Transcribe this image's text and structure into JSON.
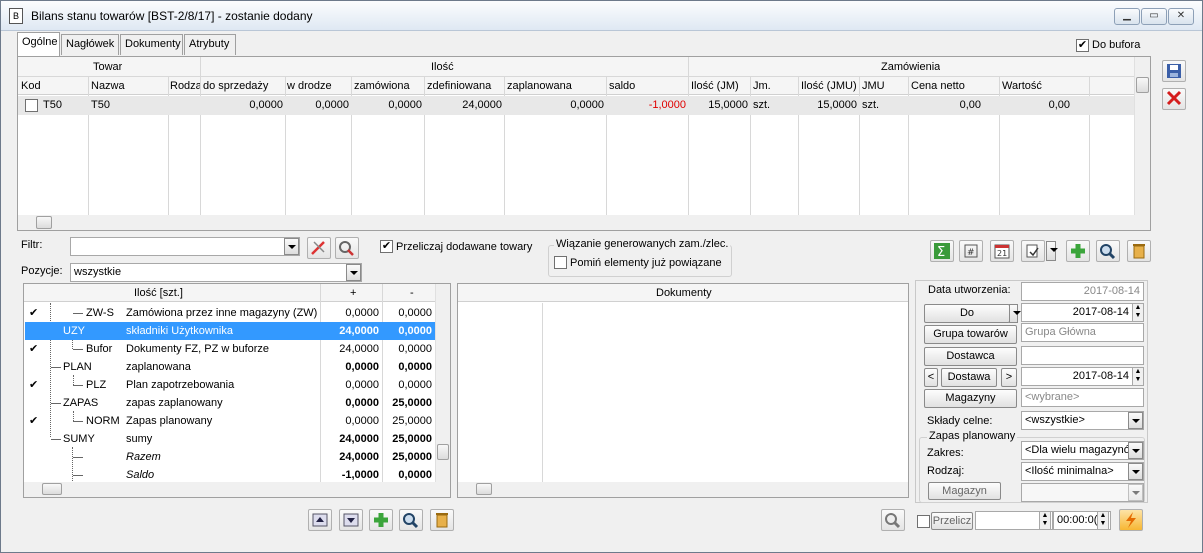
{
  "window": {
    "title": "Bilans stanu towarów [BST-2/8/17] - zostanie dodany",
    "min": "▁",
    "max": "▭",
    "close": "✕"
  },
  "tabs": [
    "Ogólne",
    "Nagłówek",
    "Dokumenty",
    "Atrybuty"
  ],
  "do_bufora": "Do bufora",
  "grid": {
    "groups": {
      "towar": "Towar",
      "ilosc": "Ilość",
      "zamowienia": "Zamówienia"
    },
    "columns": [
      "Kod",
      "Nazwa",
      "Rodza",
      "do sprzedaży",
      "w drodze",
      "zamówiona",
      "zdefiniowana",
      "zaplanowana",
      "saldo",
      "Ilość (JM)",
      "Jm.",
      "Ilość (JMU)",
      "JMU",
      "Cena netto",
      "Wartość"
    ],
    "row": [
      "T50",
      "T50",
      "",
      "0,0000",
      "0,0000",
      "0,0000",
      "24,0000",
      "0,0000",
      "-1,0000",
      "15,0000",
      "szt.",
      "15,0000",
      "szt.",
      "0,00",
      "0,00"
    ]
  },
  "filtr_label": "Filtr:",
  "filtr_value": "",
  "przeliczaj": "Przeliczaj dodawane towary",
  "wiazanie": "Wiązanie generowanych zam./zlec.",
  "pomin": "Pomiń elementy już powiązane",
  "pozycje_label": "Pozycje:",
  "pozycje_value": "wszystkie",
  "tree": {
    "headers": [
      "Ilość [szt.]",
      "+",
      "-"
    ],
    "rows": [
      {
        "code": "ZW-S",
        "name": "Zamówiona przez inne magazyny (ZW)",
        "plus": "0,0000",
        "minus": "0,0000"
      },
      {
        "code": "UZY",
        "name": "składniki Użytkownika",
        "plus": "24,0000",
        "minus": "0,0000"
      },
      {
        "code": "Bufor",
        "name": "Dokumenty FZ, PZ w buforze",
        "plus": "24,0000",
        "minus": "0,0000"
      },
      {
        "code": "PLAN",
        "name": "zaplanowana",
        "plus": "0,0000",
        "minus": "0,0000"
      },
      {
        "code": "PLZ",
        "name": "Plan zapotrzebowania",
        "plus": "0,0000",
        "minus": "0,0000"
      },
      {
        "code": "ZAPAS",
        "name": "zapas zaplanowany",
        "plus": "0,0000",
        "minus": "25,0000"
      },
      {
        "code": "NORM",
        "name": "Zapas planowany",
        "plus": "0,0000",
        "minus": "25,0000"
      },
      {
        "code": "SUMY",
        "name": "sumy",
        "plus": "24,0000",
        "minus": "25,0000"
      },
      {
        "code": "",
        "name": "Razem",
        "plus": "24,0000",
        "minus": "25,0000"
      },
      {
        "code": "",
        "name": "Saldo",
        "plus": "-1,0000",
        "minus": "0,0000"
      }
    ]
  },
  "dokumenty": "Dokumenty",
  "right": {
    "data_utworzenia": "Data utworzenia:",
    "data_utworzenia_val": "2017-08-14",
    "do": "Do",
    "do_val": "2017-08-14",
    "grupa": "Grupa towarów",
    "grupa_val": "Grupa Główna",
    "dostawca": "Dostawca",
    "dostawa": "Dostawa",
    "dostawa_val": "2017-08-14",
    "magazyny": "Magazyny",
    "magazyny_val": "<wybrane>",
    "sklady": "Składy celne:",
    "sklady_val": "<wszystkie>",
    "zapas": "Zapas planowany",
    "zakres": "Zakres:",
    "zakres_val": "<Dla wielu magazynó",
    "rodzaj": "Rodzaj:",
    "rodzaj_val": "<Ilość minimalna>",
    "magazyn": "Magazyn",
    "przelicz": "Przelicz",
    "time": "00:00:0("
  }
}
